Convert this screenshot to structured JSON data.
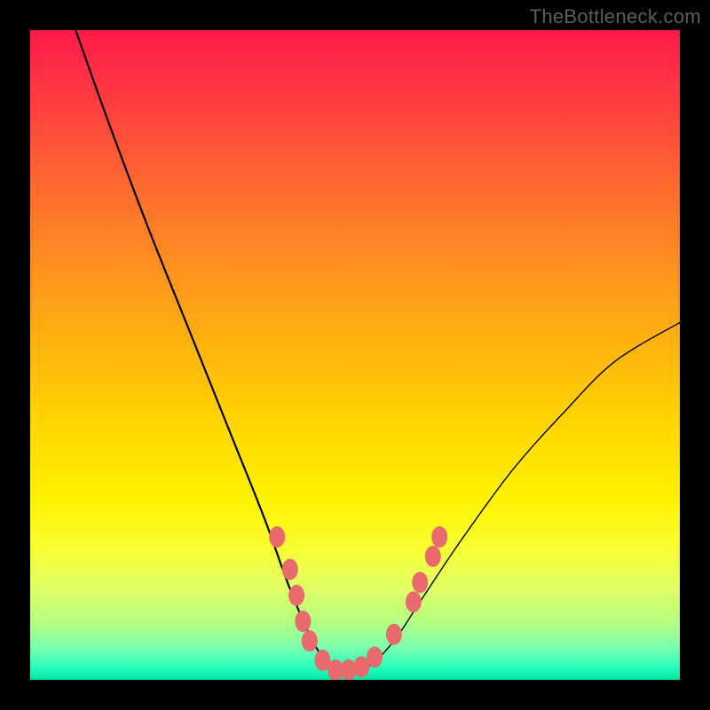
{
  "watermark": "TheBottleneck.com",
  "chart_data": {
    "type": "line",
    "title": "",
    "xlabel": "",
    "ylabel": "",
    "xlim": [
      0,
      100
    ],
    "ylim": [
      0,
      100
    ],
    "grid": false,
    "legend": false,
    "background_gradient": {
      "direction": "vertical",
      "stops": [
        {
          "pos": 0,
          "color": "#ff1a4a"
        },
        {
          "pos": 50,
          "color": "#ffd400"
        },
        {
          "pos": 80,
          "color": "#f7ff33"
        },
        {
          "pos": 100,
          "color": "#00e6a8"
        }
      ]
    },
    "curve": {
      "description": "V-shaped bottleneck curve; minimum near x≈48; left branch reaches y≈100 at x≈7; right branch rises to y≈55 at x≈100",
      "points": [
        {
          "x": 7,
          "y": 100
        },
        {
          "x": 12,
          "y": 86
        },
        {
          "x": 18,
          "y": 70
        },
        {
          "x": 24,
          "y": 55
        },
        {
          "x": 30,
          "y": 40
        },
        {
          "x": 36,
          "y": 25
        },
        {
          "x": 40,
          "y": 14
        },
        {
          "x": 44,
          "y": 5
        },
        {
          "x": 48,
          "y": 1
        },
        {
          "x": 52,
          "y": 2
        },
        {
          "x": 56,
          "y": 6
        },
        {
          "x": 60,
          "y": 12
        },
        {
          "x": 66,
          "y": 21
        },
        {
          "x": 74,
          "y": 32
        },
        {
          "x": 82,
          "y": 41
        },
        {
          "x": 90,
          "y": 49
        },
        {
          "x": 100,
          "y": 55
        }
      ]
    },
    "markers": {
      "description": "Pink dot markers clustered near the curve bottom/shoulders",
      "color": "#e86a6c",
      "points": [
        {
          "x": 38,
          "y": 22
        },
        {
          "x": 40,
          "y": 17
        },
        {
          "x": 41,
          "y": 13
        },
        {
          "x": 42,
          "y": 9
        },
        {
          "x": 43,
          "y": 6
        },
        {
          "x": 45,
          "y": 3
        },
        {
          "x": 47,
          "y": 1.5
        },
        {
          "x": 49,
          "y": 1.5
        },
        {
          "x": 51,
          "y": 2
        },
        {
          "x": 53,
          "y": 3.5
        },
        {
          "x": 56,
          "y": 7
        },
        {
          "x": 59,
          "y": 12
        },
        {
          "x": 60,
          "y": 15
        },
        {
          "x": 62,
          "y": 19
        },
        {
          "x": 63,
          "y": 22
        }
      ]
    }
  }
}
